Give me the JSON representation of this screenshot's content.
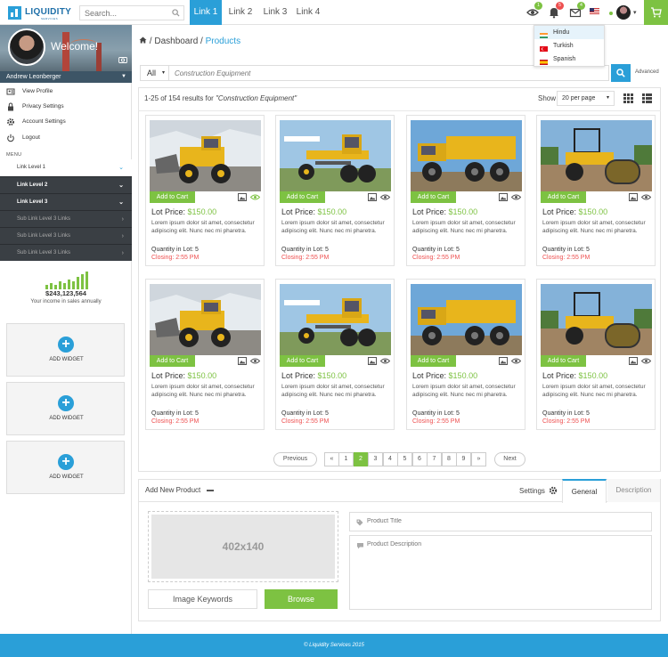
{
  "brand": {
    "name": "LIQUIDITY",
    "sub": "SERVICES"
  },
  "topbar": {
    "search_placeholder": "Search...",
    "nav": [
      "Link 1",
      "Link 2",
      "Link 3",
      "Link 4"
    ],
    "badges": {
      "views": "1",
      "notifications": "5",
      "messages": "4"
    },
    "accent": "#2a9fd8",
    "cart_color": "#7dc242"
  },
  "languages": [
    "Hindu",
    "Turkish",
    "Spanish"
  ],
  "sidebar": {
    "welcome": "Welcome!",
    "username": "Andrew Leonberger",
    "menu_items": [
      {
        "label": "View Profile",
        "icon": "user-icon"
      },
      {
        "label": "Privacy Settings",
        "icon": "lock-icon"
      },
      {
        "label": "Account Settings",
        "icon": "gear-icon"
      },
      {
        "label": "Logout",
        "icon": "power-icon"
      }
    ],
    "menu_heading": "MENU",
    "levels": [
      {
        "label": "Link Level 1",
        "style": "light"
      },
      {
        "label": "Link Level 2",
        "style": "dark"
      },
      {
        "label": "Link Level 3",
        "style": "dark"
      },
      {
        "label": "Sub Link Level 3 Links",
        "style": "dark2"
      },
      {
        "label": "Sub Link Level 3 Links",
        "style": "dark2"
      },
      {
        "label": "Sub Link Level 3 Links",
        "style": "dark2"
      }
    ],
    "income_value": "$243,123,564",
    "income_label": "Your income in sales annually",
    "widgets": [
      "ADD WIDGET",
      "ADD WIDGET",
      "ADD WIDGET"
    ]
  },
  "breadcrumb": {
    "parent": "Dashboard",
    "current": "Products"
  },
  "search": {
    "filter": "All",
    "placeholder": "Construction Equipment",
    "advanced": "Advanced"
  },
  "results": {
    "count_text": "1-25 of 154 results for",
    "query": "\"Construction Equipment\"",
    "show_label": "Show",
    "per_page": "20 per page"
  },
  "products": [
    {
      "image": "wheel-loader",
      "add_label": "Add to Cart",
      "price_label": "Lot Price:",
      "price": "$150.00",
      "description": "Lorem ipsum dolor sit amet, consectetur adipiscing elit. Nunc nec mi pharetra.",
      "quantity": "Quantity in Lot: 5",
      "closing": "Closing: 2:55 PM"
    },
    {
      "image": "motor-grader",
      "add_label": "Add to Cart",
      "price_label": "Lot Price:",
      "price": "$150.00",
      "description": "Lorem ipsum dolor sit amet, consectetur adipiscing elit. Nunc nec mi pharetra.",
      "quantity": "Quantity in Lot: 5",
      "closing": "Closing: 2:55 PM"
    },
    {
      "image": "dump-truck",
      "add_label": "Add to Cart",
      "price_label": "Lot Price:",
      "price": "$150.00",
      "description": "Lorem ipsum dolor sit amet, consectetur adipiscing elit. Nunc nec mi pharetra.",
      "quantity": "Quantity in Lot: 5",
      "closing": "Closing: 2:55 PM"
    },
    {
      "image": "road-roller",
      "add_label": "Add to Cart",
      "price_label": "Lot Price:",
      "price": "$150.00",
      "description": "Lorem ipsum dolor sit amet, consectetur adipiscing elit. Nunc nec mi pharetra.",
      "quantity": "Quantity in Lot: 5",
      "closing": "Closing: 2:55 PM"
    },
    {
      "image": "wheel-loader",
      "add_label": "Add to Cart",
      "price_label": "Lot Price:",
      "price": "$150.00",
      "description": "Lorem ipsum dolor sit amet, consectetur adipiscing elit. Nunc nec mi pharetra.",
      "quantity": "Quantity in Lot: 5",
      "closing": "Closing: 2:55 PM"
    },
    {
      "image": "motor-grader",
      "add_label": "Add to Cart",
      "price_label": "Lot Price:",
      "price": "$150.00",
      "description": "Lorem ipsum dolor sit amet, consectetur adipiscing elit. Nunc nec mi pharetra.",
      "quantity": "Quantity in Lot: 5",
      "closing": "Closing: 2:55 PM"
    },
    {
      "image": "dump-truck",
      "add_label": "Add to Cart",
      "price_label": "Lot Price:",
      "price": "$150.00",
      "description": "Lorem ipsum dolor sit amet, consectetur adipiscing elit. Nunc nec mi pharetra.",
      "quantity": "Quantity in Lot: 5",
      "closing": "Closing: 2:55 PM"
    },
    {
      "image": "road-roller",
      "add_label": "Add to Cart",
      "price_label": "Lot Price:",
      "price": "$150.00",
      "description": "Lorem ipsum dolor sit amet, consectetur adipiscing elit. Nunc nec mi pharetra.",
      "quantity": "Quantity in Lot: 5",
      "closing": "Closing: 2:55 PM"
    }
  ],
  "pagination": {
    "previous": "Previous",
    "next": "Next",
    "first": "«",
    "last": "»",
    "pages": [
      "1",
      "2",
      "3",
      "4",
      "5",
      "6",
      "7",
      "8",
      "9"
    ],
    "current": "2"
  },
  "add_product": {
    "title": "Add New Product",
    "settings": "Settings",
    "tabs": [
      "General",
      "Description"
    ],
    "image_placeholder": "402x140",
    "keywords_button": "Image Keywords",
    "browse_button": "Browse",
    "title_placeholder": "Product Title",
    "description_placeholder": "Product Description"
  },
  "footer": {
    "text": "© Liquidity Services 2015"
  }
}
